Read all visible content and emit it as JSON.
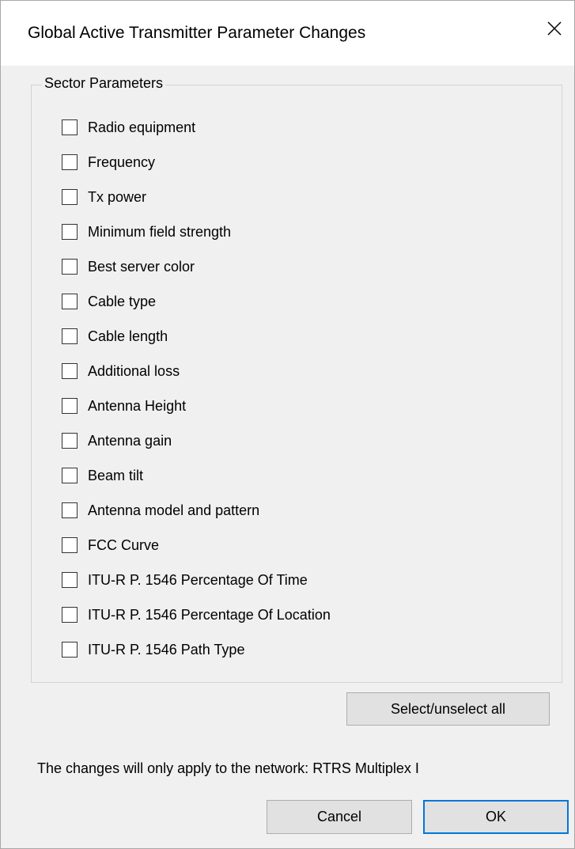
{
  "dialog": {
    "title": "Global Active Transmitter Parameter Changes",
    "close_icon": "close-icon"
  },
  "group": {
    "title": "Sector Parameters",
    "items": [
      {
        "label": "Radio equipment",
        "checked": false
      },
      {
        "label": "Frequency",
        "checked": false
      },
      {
        "label": "Tx power",
        "checked": false
      },
      {
        "label": "Minimum field strength",
        "checked": false
      },
      {
        "label": "Best server color",
        "checked": false
      },
      {
        "label": "Cable type",
        "checked": false
      },
      {
        "label": "Cable length",
        "checked": false
      },
      {
        "label": "Additional loss",
        "checked": false
      },
      {
        "label": "Antenna Height",
        "checked": false
      },
      {
        "label": "Antenna gain",
        "checked": false
      },
      {
        "label": "Beam tilt",
        "checked": false
      },
      {
        "label": "Antenna model and pattern",
        "checked": false
      },
      {
        "label": "FCC Curve",
        "checked": false
      },
      {
        "label": "ITU-R P. 1546 Percentage Of Time",
        "checked": false
      },
      {
        "label": "ITU-R P. 1546 Percentage Of Location",
        "checked": false
      },
      {
        "label": "ITU-R P. 1546 Path Type",
        "checked": false
      }
    ],
    "select_all_label": "Select/unselect all"
  },
  "footer": {
    "notice": "The changes will only apply to the network: RTRS Multiplex I",
    "cancel_label": "Cancel",
    "ok_label": "OK"
  },
  "colors": {
    "dialog_background": "#f0f0f0",
    "titlebar_background": "#ffffff",
    "button_background": "#e1e1e1",
    "default_button_border": "#0078d7"
  }
}
